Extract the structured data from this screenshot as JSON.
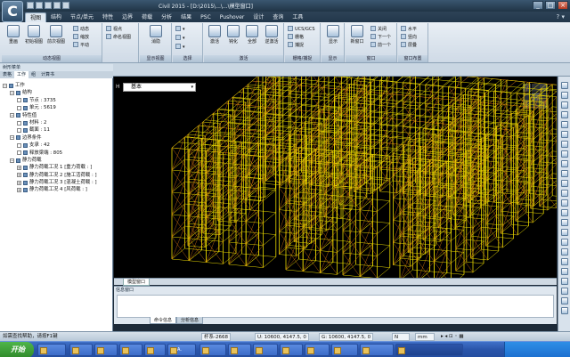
{
  "app": {
    "window_title": "Civil 2015 - [D:\\2015\\...\\...\\模型窗口]",
    "logo": "C"
  },
  "menu_tabs": [
    "视图",
    "结构",
    "节点/单元",
    "特性",
    "边界",
    "荷载",
    "分析",
    "结果",
    "PSC",
    "Pushover",
    "设计",
    "查询",
    "工具"
  ],
  "menu_active": "视图",
  "ribbon": {
    "groups": [
      {
        "label": "动态视图",
        "buttons": [
          "重画",
          "初始视图",
          "前次视图"
        ],
        "small": [
          "动态",
          "缩放",
          "平动",
          "视点",
          "命名视图"
        ]
      },
      {
        "label": "显示视图",
        "buttons": [
          "消隐"
        ],
        "small": []
      },
      {
        "label": "选择",
        "buttons": [],
        "small": []
      },
      {
        "label": "激活",
        "buttons": [
          "激活",
          "钝化",
          "全部",
          "逆激活"
        ],
        "small": []
      },
      {
        "label": "栅格/捕捉",
        "buttons": [],
        "small": [
          "UCS/GCS",
          "栅格",
          "捕捉"
        ]
      },
      {
        "label": "显示",
        "buttons": [
          "显示"
        ],
        "small": []
      },
      {
        "label": "窗口",
        "buttons": [
          "新窗口"
        ],
        "small": [
          "关闭",
          "下一个",
          "前一个"
        ]
      },
      {
        "label": "窗口布置",
        "buttons": [],
        "small": [
          "水平",
          "竖向",
          "层叠"
        ]
      }
    ]
  },
  "left_panel": {
    "title": "树形菜单",
    "tabs": [
      "表格",
      "工作",
      "组",
      "计算书"
    ],
    "active_tab": "工作",
    "tree": [
      {
        "indent": 0,
        "label": "工作"
      },
      {
        "indent": 1,
        "label": "结构"
      },
      {
        "indent": 2,
        "label": "节点 :",
        "value": "3735"
      },
      {
        "indent": 2,
        "label": "单元 :",
        "value": "5619"
      },
      {
        "indent": 1,
        "label": "特性值"
      },
      {
        "indent": 2,
        "label": "材料 :",
        "value": "2"
      },
      {
        "indent": 2,
        "label": "截面 :",
        "value": "11"
      },
      {
        "indent": 1,
        "label": "边界条件"
      },
      {
        "indent": 2,
        "label": "支承 :",
        "value": "42"
      },
      {
        "indent": 2,
        "label": "释放梁端 :",
        "value": "805"
      },
      {
        "indent": 1,
        "label": "静力荷载"
      },
      {
        "indent": 2,
        "label": "静力荷载工况 1 [重力荷载 : ]"
      },
      {
        "indent": 2,
        "label": "静力荷载工况 2 [施工活荷载 : ]"
      },
      {
        "indent": 2,
        "label": "静力荷载工况 3 [混凝土荷载 : ]"
      },
      {
        "indent": 2,
        "label": "静力荷载工况 4 [风荷载 : ]"
      }
    ]
  },
  "viewport": {
    "view_select": "基本",
    "axis_label": "H",
    "tab_label": "模型窗口"
  },
  "message_window": {
    "title": "信息窗口",
    "tabs": [
      "命令信息",
      "分析信息"
    ],
    "active_tab": "命令信息"
  },
  "status_bar": {
    "help": "如需查找帮助，请按F1键",
    "field1": "杆系-2668",
    "coord_u": "U: 10600, 4147.5, 0",
    "coord_g": "G: 10600, 4147.5, 0",
    "unit_force": "N",
    "unit_length": "mm",
    "icons": [
      "arrow-icon",
      "lock-icon",
      "zoom-icon"
    ]
  },
  "taskbar": {
    "start": "开始",
    "items": [
      "",
      "",
      "",
      "",
      "",
      "A.",
      "",
      "",
      "",
      "",
      "",
      "",
      "",
      ""
    ],
    "clock": "",
    "colors": {
      "taskbar": "#2a55aa",
      "start": "#2f8a2a"
    }
  },
  "colors": {
    "structure_yellow": "#e8d800",
    "structure_orange": "#e07a10",
    "viewport_bg": "#000000"
  }
}
